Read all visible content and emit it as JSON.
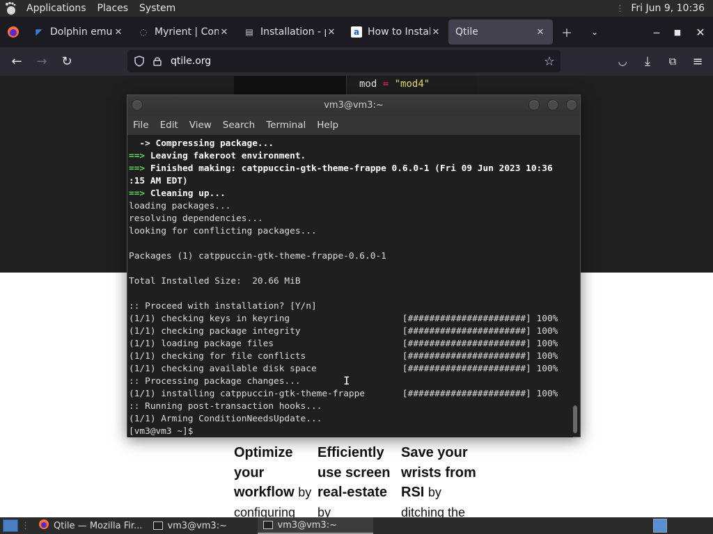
{
  "top_panel": {
    "menus": [
      "Applications",
      "Places",
      "System"
    ],
    "clock": "Fri Jun 9, 10:36"
  },
  "browser": {
    "tabs": [
      {
        "label": "Dolphin emulat",
        "icon": "dolphin-icon",
        "active": false
      },
      {
        "label": "Myrient | Conte",
        "icon": "loading-icon",
        "active": false
      },
      {
        "label": "Installation - pip",
        "icon": "docs-icon",
        "active": false
      },
      {
        "label": "How to Install a",
        "icon": "a-icon",
        "active": false
      },
      {
        "label": "Qtile",
        "icon": "",
        "active": true
      }
    ],
    "url": "qtile.org"
  },
  "page": {
    "code_line": {
      "var": "mod",
      "op": "=",
      "str": "\"mod4\""
    },
    "features": [
      {
        "bold": [
          "Optimize",
          "your",
          "workflow"
        ],
        "rest": "by",
        "tail": "configuring"
      },
      {
        "bold": [
          "Efficiently",
          "use screen",
          "real-estate"
        ],
        "rest": "",
        "tail": "by"
      },
      {
        "bold": [
          "Save your",
          "wrists from",
          "RSI"
        ],
        "rest": "by",
        "tail": "ditching the"
      }
    ]
  },
  "terminal": {
    "title": "vm3@vm3:~",
    "menu": [
      "File",
      "Edit",
      "View",
      "Search",
      "Terminal",
      "Help"
    ],
    "lines": [
      {
        "prefix": "",
        "text": "  -> Compressing package...",
        "style": "bold"
      },
      {
        "prefix": "==>",
        "text": " Leaving fakeroot environment.",
        "style": "bold"
      },
      {
        "prefix": "==>",
        "text": " Finished making: catppuccin-gtk-theme-frappe 0.6.0-1 (Fri 09 Jun 2023 10:36",
        "style": "bold"
      },
      {
        "prefix": "",
        "text": ":15 AM EDT)",
        "style": "bold"
      },
      {
        "prefix": "==>",
        "text": " Cleaning up...",
        "style": "bold"
      },
      {
        "prefix": "",
        "text": "loading packages...",
        "style": ""
      },
      {
        "prefix": "",
        "text": "resolving dependencies...",
        "style": ""
      },
      {
        "prefix": "",
        "text": "looking for conflicting packages...",
        "style": ""
      },
      {
        "prefix": "",
        "text": "",
        "style": ""
      },
      {
        "prefix": "",
        "text": "Packages (1) catppuccin-gtk-theme-frappe-0.6.0-1",
        "style": ""
      },
      {
        "prefix": "",
        "text": "",
        "style": ""
      },
      {
        "prefix": "",
        "text": "Total Installed Size:  20.66 MiB",
        "style": ""
      },
      {
        "prefix": "",
        "text": "",
        "style": ""
      },
      {
        "prefix": "",
        "text": ":: Proceed with installation? [Y/n]",
        "style": ""
      },
      {
        "prefix": "",
        "text": "(1/1) checking keys in keyring                     [######################] 100%",
        "style": ""
      },
      {
        "prefix": "",
        "text": "(1/1) checking package integrity                   [######################] 100%",
        "style": ""
      },
      {
        "prefix": "",
        "text": "(1/1) loading package files                        [######################] 100%",
        "style": ""
      },
      {
        "prefix": "",
        "text": "(1/1) checking for file conflicts                  [######################] 100%",
        "style": ""
      },
      {
        "prefix": "",
        "text": "(1/1) checking available disk space                [######################] 100%",
        "style": ""
      },
      {
        "prefix": "",
        "text": ":: Processing package changes...",
        "style": ""
      },
      {
        "prefix": "",
        "text": "(1/1) installing catppuccin-gtk-theme-frappe       [######################] 100%",
        "style": ""
      },
      {
        "prefix": "",
        "text": ":: Running post-transaction hooks...",
        "style": ""
      },
      {
        "prefix": "",
        "text": "(1/1) Arming ConditionNeedsUpdate...",
        "style": ""
      },
      {
        "prefix": "",
        "text": "[vm3@vm3 ~]$",
        "style": ""
      }
    ]
  },
  "taskbar": {
    "tasks": [
      {
        "label": "Qtile — Mozilla Fir...",
        "icon": "firefox-icon",
        "active": false
      },
      {
        "label": "vm3@vm3:~",
        "icon": "terminal-icon",
        "active": false
      },
      {
        "label": "vm3@vm3:~",
        "icon": "terminal-icon",
        "active": true
      }
    ]
  }
}
